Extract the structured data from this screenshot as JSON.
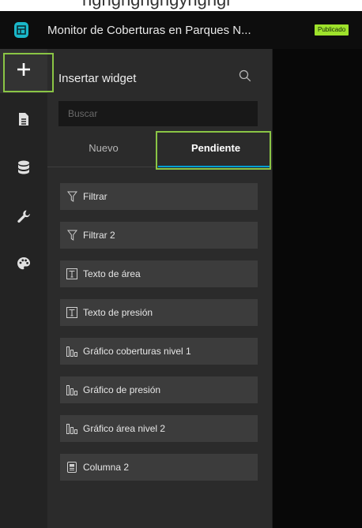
{
  "app": {
    "title": "Monitor de Coberturas en Parques N...",
    "status_badge": "Publicado",
    "clipped_text": "ngngngngngyngngi"
  },
  "rail": {
    "items": [
      {
        "name": "plus-icon",
        "active": true
      },
      {
        "name": "page-icon",
        "active": false
      },
      {
        "name": "data-icon",
        "active": false
      },
      {
        "name": "wrench-icon",
        "active": false
      },
      {
        "name": "palette-icon",
        "active": false
      }
    ]
  },
  "panel": {
    "title": "Insertar widget",
    "search_placeholder": "Buscar",
    "tabs": [
      {
        "label": "Nuevo",
        "selected": false
      },
      {
        "label": "Pendiente",
        "selected": true
      }
    ],
    "widgets": [
      {
        "label": "Filtrar",
        "icon": "filter-icon"
      },
      {
        "label": "Filtrar 2",
        "icon": "filter-icon"
      },
      {
        "label": "Texto de área",
        "icon": "text-icon"
      },
      {
        "label": "Texto de presión",
        "icon": "text-icon"
      },
      {
        "label": "Gráfico coberturas nivel 1",
        "icon": "bar-chart-icon"
      },
      {
        "label": "Gráfico de presión",
        "icon": "bar-chart-icon"
      },
      {
        "label": "Gráfico área nivel 2",
        "icon": "bar-chart-icon"
      },
      {
        "label": "Columna 2",
        "icon": "column-icon"
      }
    ]
  },
  "colors": {
    "accent_teal": "#1ab7c9",
    "badge_green": "#9ee22b",
    "tab_underline": "#00a0d3",
    "highlight_green": "#8ac545"
  }
}
